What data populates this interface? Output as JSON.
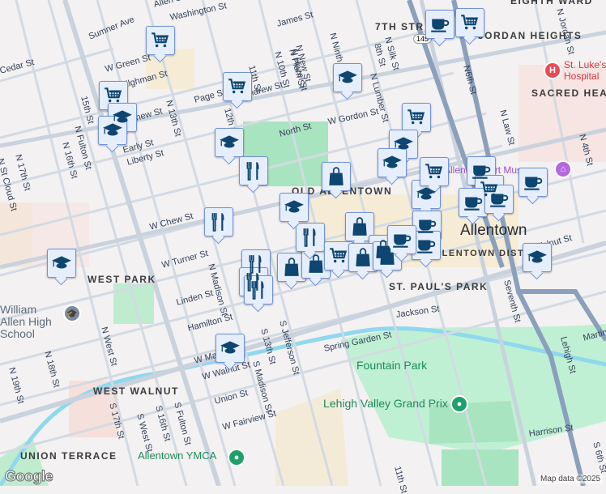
{
  "neighborhoods": {
    "eighth_ward": "EIGHTH WARD",
    "seventh_street": "7TH STR",
    "jordan_heights": "JORDAN HEIGHTS",
    "sacred_heart": "SACRED HEART",
    "old_allentown": "OLD ALLENTOWN",
    "west_park": "WEST PARK",
    "st_pauls_park": "ST. PAUL'S PARK",
    "west_walnut": "WEST WALNUT",
    "union_terrace": "UNION TERRACE",
    "downtown": "ALLENTOWN DISTRICT"
  },
  "city": "Allentown",
  "route_shield": "145",
  "pois": {
    "st_lukes": "St. Luke's Hospital",
    "art_museum": "Allentown Art Museum",
    "william_allen": "William Allen High School",
    "fountain_park": "Fountain Park",
    "grand_prix": "Lehigh Valley Grand Prix",
    "ymca": "Allentown YMCA"
  },
  "streets": [
    "Sumner Ave",
    "Washington St",
    "W Green St",
    "Tilghman St",
    "Page St",
    "Chew St",
    "Allen St",
    "Cedar St",
    "15th St",
    "N Fulton St",
    "N 16th St",
    "N 17th St",
    "N St Cloud St",
    "Early St",
    "Liberty St",
    "N 13th St",
    "12th St",
    "11th St",
    "Andrew St",
    "James St",
    "N 10th St",
    "N Plum St",
    "N Hazel St",
    "N New St",
    "N Ninth St",
    "N Silk St",
    "8th St",
    "N Lumber St",
    "North St",
    "W Gordon St",
    "W Chew St",
    "W Turner St",
    "N Madison St",
    "Linden St",
    "Hamilton St",
    "N West St",
    "N 18th St",
    "N 19th St",
    "W Maple St",
    "W Walnut St",
    "S 17th St",
    "S West St",
    "S 16th St",
    "S Fulton St",
    "S Madison St",
    "S 13th St",
    "S Jefferson St",
    "Union St",
    "W Fairview St",
    "Jackson St",
    "Spring Garden St",
    "N6th St",
    "N Law St",
    "N 4th St",
    "Seventh St",
    "Lehigh St",
    "Martin",
    "S 6th St",
    "Harrison St",
    "11th St",
    "N Jordan St",
    "Walnut St"
  ],
  "markers": [
    "cart-icon",
    "cart-icon",
    "graduation-cap-icon",
    "graduation-cap-icon",
    "cart-icon",
    "graduation-cap-icon",
    "restaurant-icon",
    "restaurant-icon",
    "graduation-cap-icon",
    "graduation-cap-icon",
    "restaurant-icon",
    "restaurant-icon",
    "restaurant-icon",
    "shopping-bag-icon",
    "shopping-bag-icon",
    "restaurant-icon",
    "coffee-icon",
    "cart-icon",
    "graduation-cap-icon",
    "cart-icon",
    "graduation-cap-icon",
    "graduation-cap-icon",
    "shopping-bag-icon",
    "graduation-cap-icon",
    "cart-icon",
    "graduation-cap-icon",
    "coffee-icon",
    "cart-icon",
    "coffee-icon",
    "coffee-icon",
    "coffee-icon",
    "shopping-bag-icon",
    "shopping-bag-icon",
    "cart-icon",
    "shopping-bag-icon",
    "shopping-bag-icon",
    "coffee-icon",
    "coffee-icon",
    "coffee-icon",
    "graduation-cap-icon"
  ],
  "footer": {
    "attribution": "Map data ©2025",
    "logo": "Google"
  }
}
